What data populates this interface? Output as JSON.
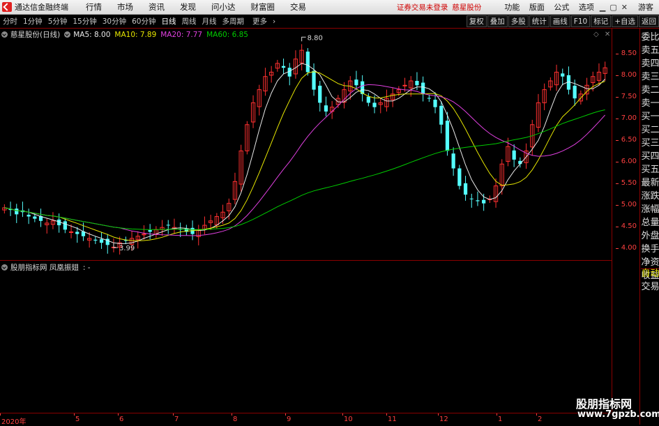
{
  "titlebar": {
    "app_title": "通达信金融终端",
    "menu": [
      "行情",
      "市场",
      "资讯",
      "发现",
      "问小达",
      "财富圈",
      "交易"
    ],
    "notice": "证券交易未登录",
    "stock_name": "慈星股份",
    "right_menu": [
      "功能",
      "版面",
      "公式",
      "选项"
    ],
    "guest": "游客"
  },
  "toolbar": {
    "periods": [
      "分时",
      "1分钟",
      "5分钟",
      "15分钟",
      "30分钟",
      "60分钟",
      "日线",
      "周线",
      "月线",
      "多周期",
      "更多"
    ],
    "active_period": "日线",
    "buttons": [
      "复权",
      "叠加",
      "多股",
      "统计",
      "画线",
      "F10",
      "标记",
      "+自选",
      "返回"
    ]
  },
  "main_chart": {
    "title": "慈星股份(日线)",
    "ma": [
      {
        "label": "MA5: 8.00",
        "color": "#e8e8e8"
      },
      {
        "label": "MA10: 7.89",
        "color": "#e6e600"
      },
      {
        "label": "MA20: 7.77",
        "color": "#e040e0"
      },
      {
        "label": "MA60: 6.85",
        "color": "#00cc00"
      }
    ],
    "high_label": "8.80",
    "low_label": "3.99"
  },
  "sub_chart": {
    "title": "股朋指标网 凤凰振翅",
    "value": ": -"
  },
  "price_axis": [
    "8.50",
    "8.00",
    "7.50",
    "7.00",
    "6.50",
    "6.00",
    "5.50",
    "5.00",
    "4.50",
    "4.00"
  ],
  "time_axis": [
    "2020年",
    "5",
    "6",
    "7",
    "8",
    "9",
    "10",
    "11",
    "12",
    "1",
    "2"
  ],
  "side_panel": [
    "委比",
    "卖五",
    "卖四",
    "卖三",
    "卖二",
    "卖一",
    "买一",
    "买二",
    "买三",
    "买四",
    "买五",
    "最新",
    "涨跌",
    "涨幅",
    "总量",
    "外盘",
    "换手",
    "净资",
    "收益",
    "自动",
    "交易"
  ],
  "watermark": {
    "line1": "股朋指标网",
    "line2": "www.7gpzb.com"
  },
  "colors": {
    "up": "#ff3030",
    "down": "#54ffff",
    "ma5": "#e8e8e8",
    "ma10": "#e6e600",
    "ma20": "#e040e0",
    "ma60": "#00cc00",
    "frame": "#8a0000"
  },
  "chart_data": {
    "type": "candlestick",
    "title": "慈星股份(日线)",
    "ylim": [
      3.8,
      8.9
    ],
    "ytick_labels": [
      "4.00",
      "4.50",
      "5.00",
      "5.50",
      "6.00",
      "6.50",
      "7.00",
      "7.50",
      "8.00",
      "8.50"
    ],
    "xtick_labels": [
      "2020年",
      "5",
      "6",
      "7",
      "8",
      "9",
      "10",
      "11",
      "12",
      "1",
      "2"
    ],
    "close_series": [
      4.9,
      4.85,
      4.75,
      4.8,
      4.7,
      4.65,
      4.6,
      4.55,
      4.6,
      4.5,
      4.4,
      4.35,
      4.3,
      4.25,
      4.2,
      4.15,
      4.1,
      4.05,
      4.0,
      4.1,
      4.15,
      4.2,
      4.25,
      4.3,
      4.35,
      4.4,
      4.45,
      4.5,
      4.45,
      4.4,
      4.35,
      4.3,
      4.4,
      4.5,
      4.6,
      4.7,
      4.8,
      5.0,
      5.5,
      6.2,
      6.8,
      7.3,
      7.6,
      7.9,
      8.0,
      8.2,
      8.1,
      7.9,
      8.3,
      8.5,
      8.0,
      7.6,
      7.3,
      7.1,
      7.2,
      7.4,
      7.6,
      7.8,
      7.7,
      7.5,
      7.3,
      7.2,
      7.3,
      7.4,
      7.5,
      7.6,
      7.7,
      7.8,
      7.7,
      7.5,
      7.4,
      7.2,
      6.8,
      6.2,
      5.8,
      5.4,
      5.2,
      5.1,
      5.05,
      5.0,
      5.1,
      5.4,
      5.9,
      6.3,
      6.0,
      5.9,
      6.2,
      6.8,
      7.3,
      7.6,
      7.8,
      8.0,
      7.9,
      7.6,
      7.4,
      7.5,
      7.7,
      7.9,
      8.0,
      8.1
    ],
    "last": {
      "ma5": 8.0,
      "ma10": 7.89,
      "ma20": 7.77,
      "ma60": 6.85
    },
    "high": 8.8,
    "low": 3.99
  }
}
